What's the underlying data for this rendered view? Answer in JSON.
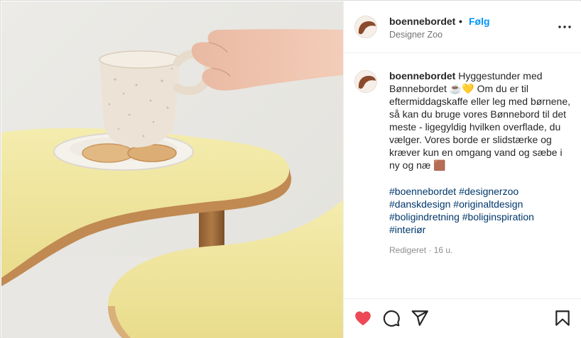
{
  "post": {
    "image_description_icon": "photo-cup-on-yellow-table",
    "colors": {
      "accent_follow": "#0095f6",
      "hashtag": "#00376b",
      "like_red": "#ed4956",
      "table_yellow": "#f2e7a4"
    }
  },
  "header": {
    "username": "boennebordet",
    "dot": "•",
    "follow_label": "Følg",
    "location": "Designer Zoo",
    "more_icon": "more-horizontal-icon"
  },
  "caption": {
    "username": "boennebordet",
    "text": " Hyggestunder med Bønnebordet ☕💛 Om du er til eftermiddagskaffe eller leg med børnene, så kan du bruge vores Bønnebord til det meste - ligegyldig hvilken overflade, du vælger. Vores borde er slidstærke og kræver kun en omgang vand og sæbe i ny og næ 🟫",
    "hashtags": [
      "#boennebordet",
      "#designerzoo",
      "#danskdesign",
      "#originaltdesign",
      "#boligindretning",
      "#boliginspiration",
      "#interiør"
    ],
    "edited": "Redigeret · 16 u."
  },
  "actions": {
    "like_icon": "heart-filled-icon",
    "comment_icon": "comment-icon",
    "share_icon": "share-icon",
    "save_icon": "bookmark-icon"
  }
}
